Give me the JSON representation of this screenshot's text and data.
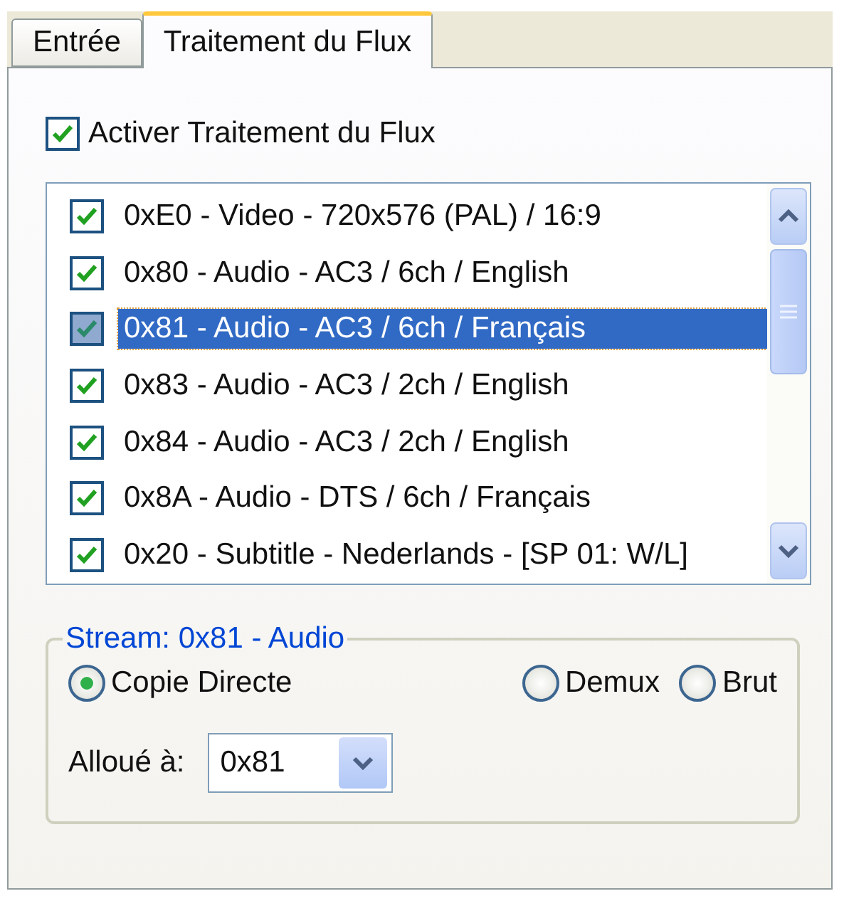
{
  "tabs": [
    {
      "label": "Entrée",
      "selected": false
    },
    {
      "label": "Traitement du Flux",
      "selected": true
    }
  ],
  "enable": {
    "label": "Activer Traitement du Flux",
    "checked": true
  },
  "streams": [
    {
      "label": "0xE0 - Video - 720x576 (PAL) / 16:9",
      "checked": true,
      "selected": false
    },
    {
      "label": "0x80 - Audio - AC3 / 6ch / English",
      "checked": true,
      "selected": false
    },
    {
      "label": "0x81 - Audio - AC3 / 6ch / Français",
      "checked": true,
      "selected": true
    },
    {
      "label": "0x83 - Audio - AC3 / 2ch / English",
      "checked": true,
      "selected": false
    },
    {
      "label": "0x84 - Audio - AC3 / 2ch / English",
      "checked": true,
      "selected": false
    },
    {
      "label": "0x8A - Audio - DTS / 6ch / Français",
      "checked": true,
      "selected": false
    },
    {
      "label": "0x20 - Subtitle - Nederlands - [SP 01: W/L]",
      "checked": true,
      "selected": false
    }
  ],
  "group": {
    "title": "Stream: 0x81 - Audio",
    "modes": [
      {
        "label": "Copie Directe",
        "selected": true
      },
      {
        "label": "Demux",
        "selected": false
      },
      {
        "label": "Brut",
        "selected": false
      }
    ],
    "assign_label": "Alloué à:",
    "assign_value": "0x81"
  }
}
